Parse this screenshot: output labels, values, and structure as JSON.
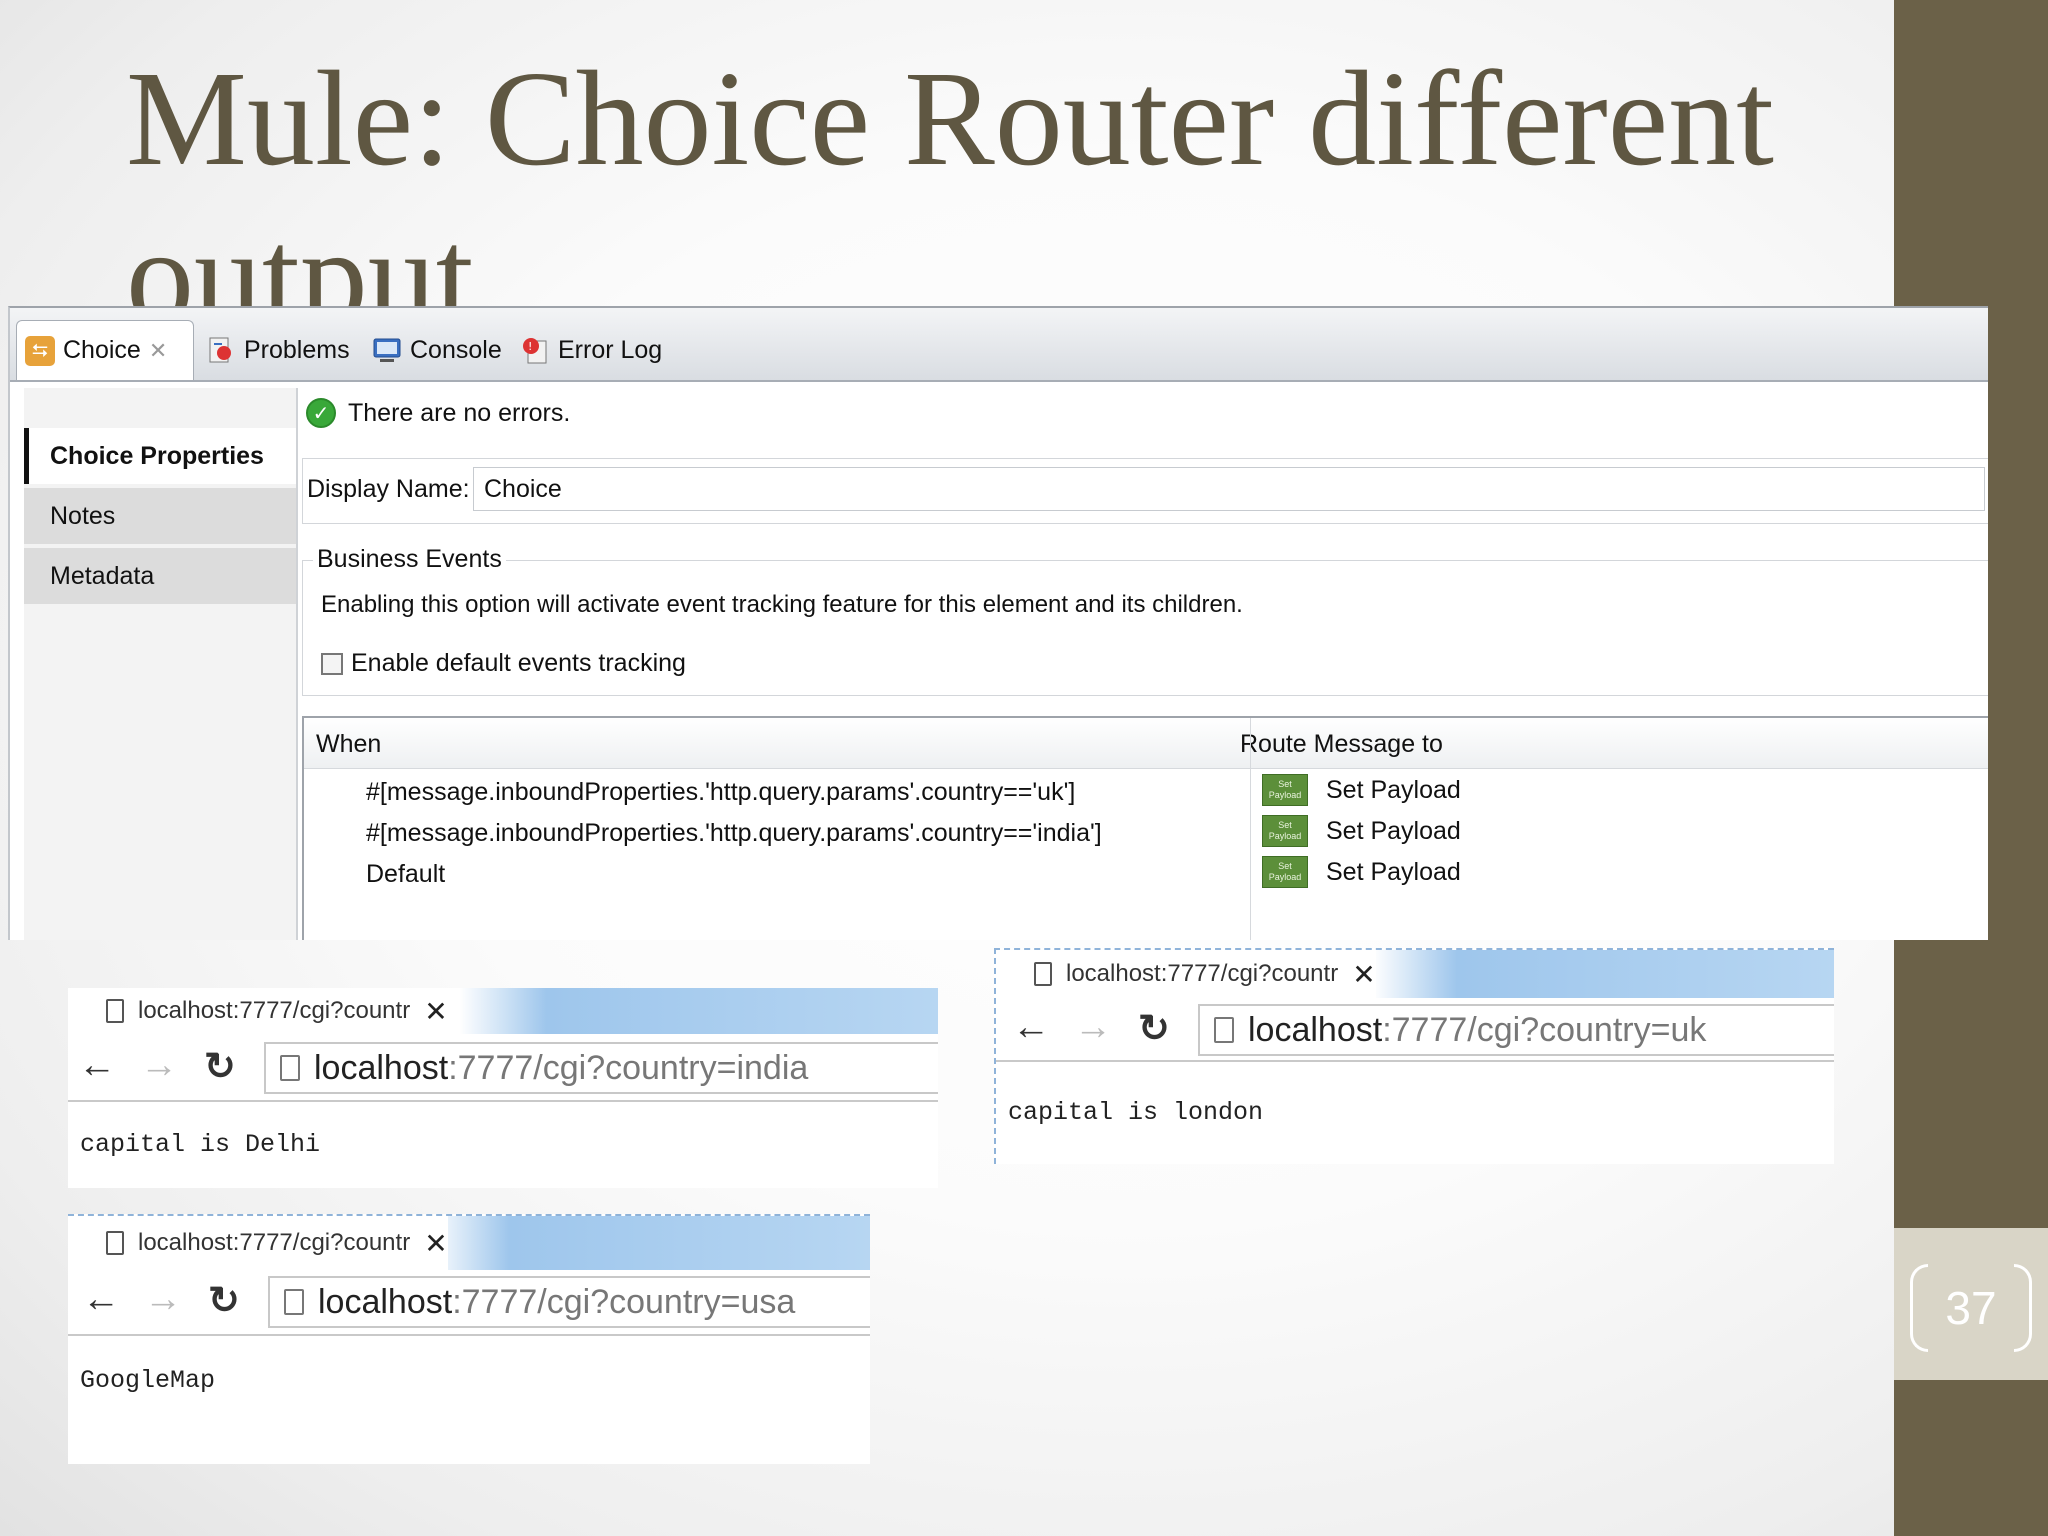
{
  "slide": {
    "title": "Mule: Choice Router different output",
    "number": "37"
  },
  "mule": {
    "tabs": [
      {
        "label": "Choice",
        "icon": "choice-icon"
      },
      {
        "label": "Problems",
        "icon": "problems-icon"
      },
      {
        "label": "Console",
        "icon": "console-icon"
      },
      {
        "label": "Error Log",
        "icon": "error-log-icon"
      }
    ],
    "nav": [
      {
        "label": "Choice Properties"
      },
      {
        "label": "Notes"
      },
      {
        "label": "Metadata"
      }
    ],
    "status": "There are no errors.",
    "display_name_label": "Display Name:",
    "display_name_value": "Choice",
    "business_events": {
      "legend": "Business Events",
      "description": "Enabling this option will activate event tracking feature for this element and its children.",
      "checkbox_label": "Enable default events tracking",
      "checked": false
    },
    "routes": {
      "headers": [
        "When",
        "Route Message to"
      ],
      "rows": [
        {
          "when": "#[message.inboundProperties.'http.query.params'.country=='uk']",
          "target": "Set Payload"
        },
        {
          "when": "#[message.inboundProperties.'http.query.params'.country=='india']",
          "target": "Set Payload"
        },
        {
          "when": "Default",
          "target": "Set Payload"
        }
      ],
      "icon_text": "Set Payload",
      "icon_color": "#5c8f3a"
    }
  },
  "browsers": [
    {
      "tab_title": "localhost:7777/cgi?countr",
      "url_host": "localhost",
      "url_rest": ":7777/cgi?country=india",
      "body": "capital is Delhi"
    },
    {
      "tab_title": "localhost:7777/cgi?countr",
      "url_host": "localhost",
      "url_rest": ":7777/cgi?country=uk",
      "body": "capital is london"
    },
    {
      "tab_title": "localhost:7777/cgi?countr",
      "url_host": "localhost",
      "url_rest": ":7777/cgi?country=usa",
      "body": "GoogleMap"
    }
  ],
  "colors": {
    "accent_band": "#6b6148",
    "title": "#5f5742"
  }
}
